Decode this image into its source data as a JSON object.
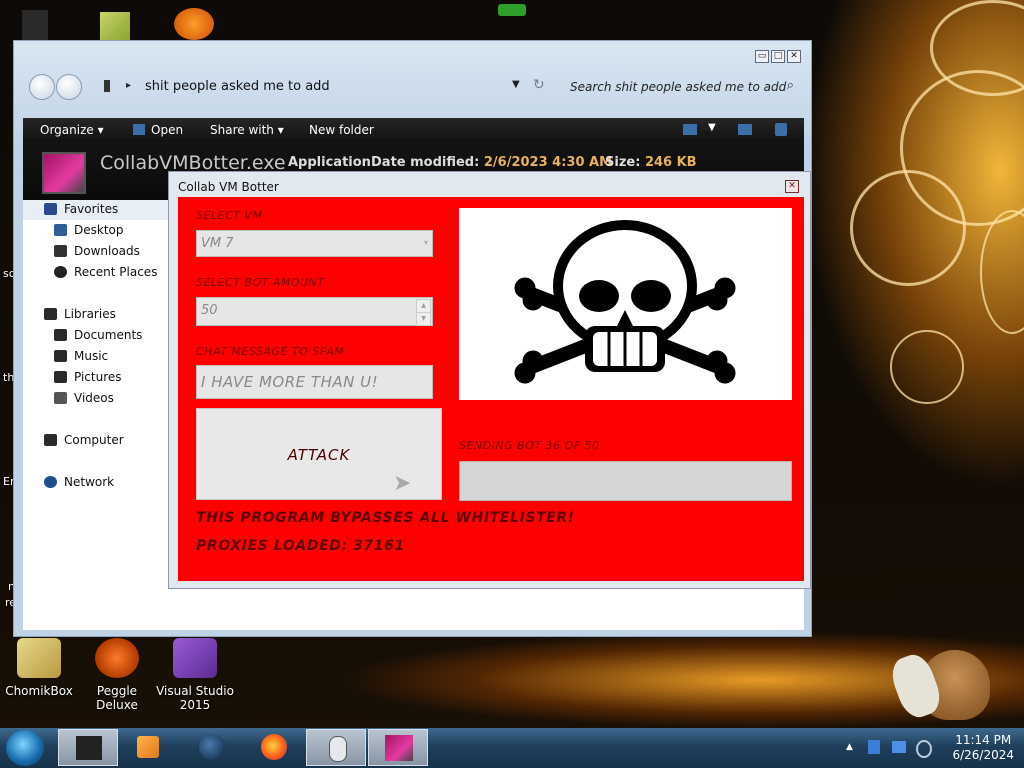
{
  "desktop": {
    "icons": [
      {
        "label": "ChomikBox"
      },
      {
        "label": "Peggle Deluxe"
      },
      {
        "label": "Visual Studio 2015"
      }
    ],
    "edge_fragments": [
      "sc",
      "th",
      "Er",
      "n",
      "re"
    ]
  },
  "explorer": {
    "window_buttons": {
      "minimize": "▭",
      "maximize": "□",
      "close": "✕"
    },
    "address_path": "shit people asked me to add",
    "search_placeholder": "Search shit people asked me to add",
    "toolbar": {
      "organize": "Organize",
      "open": "Open",
      "share_with": "Share with",
      "new_folder": "New folder"
    },
    "details": {
      "file_name": "CollabVMBotter.exe",
      "type": "Application",
      "date_modified_label": "Date modified:",
      "date_modified_value": "2/6/2023 4:30 AM",
      "size_label": "Size:",
      "size_value": "246 KB"
    },
    "nav": {
      "favorites": "Favorites",
      "desktop": "Desktop",
      "downloads": "Downloads",
      "recent_places": "Recent Places",
      "libraries": "Libraries",
      "documents": "Documents",
      "music": "Music",
      "pictures": "Pictures",
      "videos": "Videos",
      "computer": "Computer",
      "network": "Network"
    }
  },
  "botter": {
    "title": "Collab VM Botter",
    "close": "✕",
    "select_vm_label": "SELECT VM",
    "select_vm_value": "VM 7",
    "bot_amount_label": "SELECT BOT AMOUNT",
    "bot_amount_value": "50",
    "chat_label": "CHAT MESSAGE TO SPAM",
    "chat_value": "I HAVE MORE THAN U!",
    "attack_label": "ATTACK",
    "status": "SENDING BOT 36 OF 50",
    "progress_fraction": 0.0,
    "banner_1": "THIS PROGRAM BYPASSES ALL WHITELISTER!",
    "banner_2": "PROXIES LOADED: 37161"
  },
  "taskbar": {
    "time": "11:14 PM",
    "date": "6/26/2024"
  },
  "colors": {
    "panel_red": "#ff0000",
    "label_dark_red": "#7a0000",
    "taskbar_blue": "#1f3f5c"
  }
}
